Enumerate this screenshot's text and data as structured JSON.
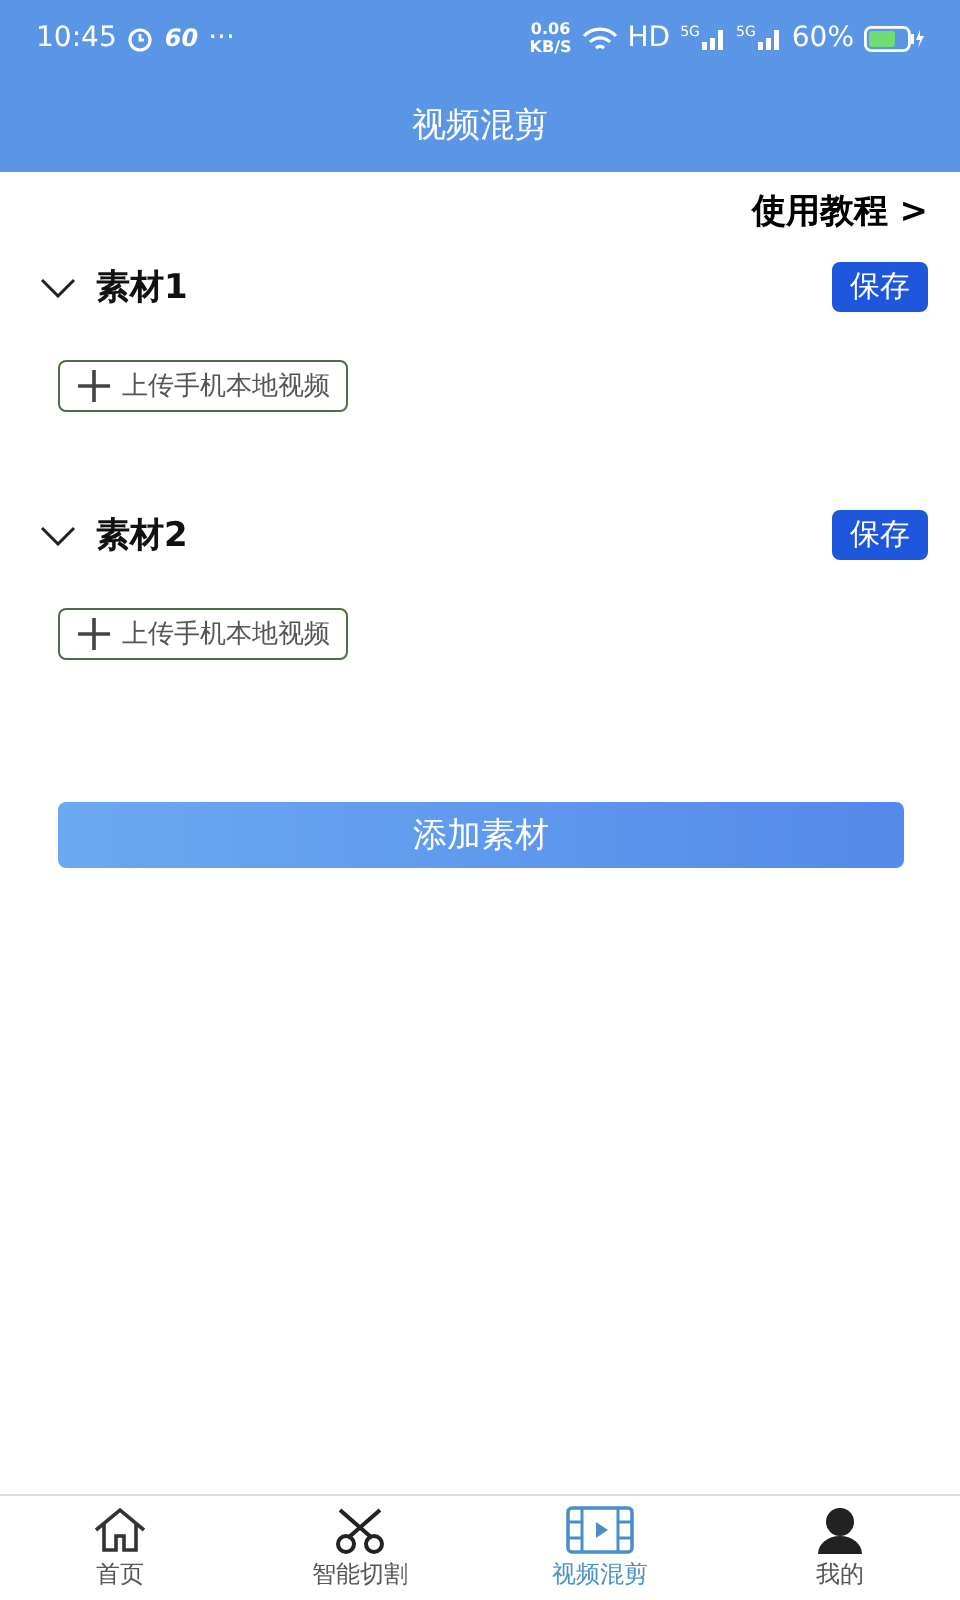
{
  "status_bar": {
    "time": "10:45",
    "refresh": "60",
    "dots": "···",
    "speed": "0.06",
    "speed_unit": "KB/S",
    "hd": "HD",
    "signal_1": "5G",
    "signal_2": "5G",
    "battery": "60%"
  },
  "title": "视频混剪",
  "tutorial_link": "使用教程 >",
  "sections": [
    {
      "title": "素材1",
      "expanded": true,
      "save": "保存",
      "upload": "上传手机本地视频"
    },
    {
      "title": "素材2",
      "expanded": true,
      "save": "保存",
      "upload": "上传手机本地视频"
    }
  ],
  "add_button": "添加素材",
  "nav": [
    {
      "kind": "home",
      "label": "首页",
      "selected": false
    },
    {
      "kind": "scissors",
      "label": "智能切割",
      "selected": false
    },
    {
      "kind": "film",
      "label": "视频混剪",
      "selected": true
    },
    {
      "kind": "person",
      "label": "我的",
      "selected": false
    }
  ]
}
